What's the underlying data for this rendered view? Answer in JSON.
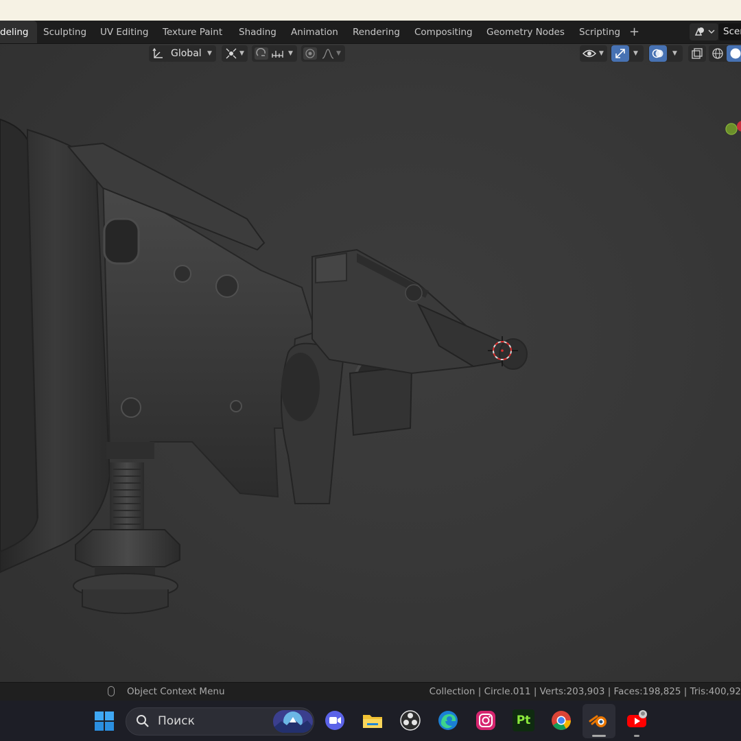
{
  "workspace_tabs": [
    {
      "label": "deling",
      "active": true
    },
    {
      "label": "Sculpting"
    },
    {
      "label": "UV Editing"
    },
    {
      "label": "Texture Paint"
    },
    {
      "label": "Shading"
    },
    {
      "label": "Animation"
    },
    {
      "label": "Rendering"
    },
    {
      "label": "Compositing"
    },
    {
      "label": "Geometry Nodes"
    },
    {
      "label": "Scripting"
    }
  ],
  "add_workspace": "+",
  "scene_name": "Scen",
  "viewport_header": {
    "transform_orientation": "Global"
  },
  "status_bar": {
    "left_hint": "Object Context Menu",
    "right_stats": "Collection | Circle.011 | Verts:203,903 | Faces:198,825 | Tris:400,92"
  },
  "taskbar": {
    "search_placeholder": "Поиск",
    "apps": [
      "windows-start-icon",
      "zoom-meeting-icon",
      "file-explorer-icon",
      "obs-studio-icon",
      "edge-icon",
      "instagram-icon",
      "pt-icon",
      "chrome-icon",
      "blender-icon",
      "youtube-icon"
    ],
    "pt_label": "Pt"
  },
  "colors": {
    "viewport_bg": "#383838",
    "header_bg": "#1d1d1d",
    "accent_blue": "#4772b3",
    "taskbar_bg": "#1d1e26"
  }
}
